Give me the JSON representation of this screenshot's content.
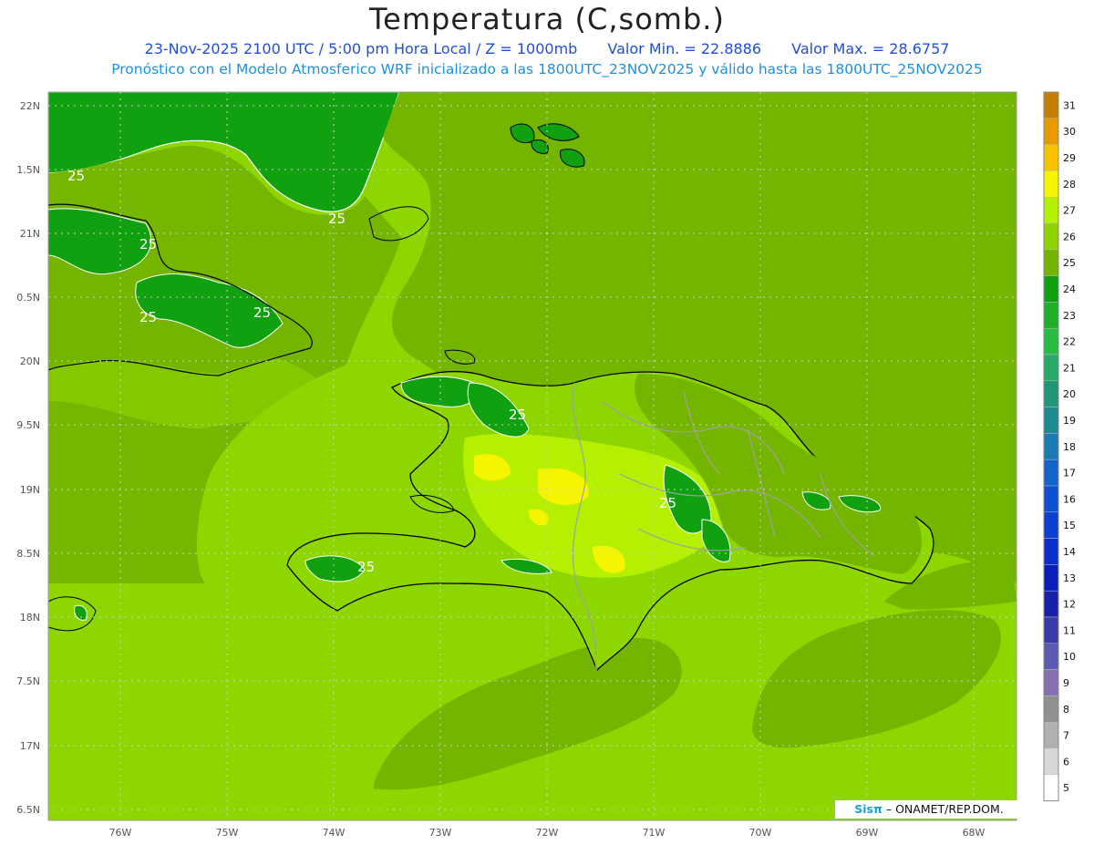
{
  "title": "Temperatura (C,somb.)",
  "subtitle": {
    "datetime": "23-Nov-2025 2100 UTC / 5:00 pm Hora Local / Z = 1000mb",
    "min": "Valor Min. = 22.8886",
    "max": "Valor Max. = 28.6757"
  },
  "model_line": "Pronóstico con el Modelo Atmosferico WRF inicializado a las 1800UTC_23NOV2025 y válido hasta las  1800UTC_25NOV2025",
  "credit": {
    "logo": "Sisπ",
    "text": "– ONAMET/REP.DOM."
  },
  "map_data": {
    "lat_labels": [
      "22N",
      "1.5N",
      "21N",
      "0.5N",
      "20N",
      "9.5N",
      "19N",
      "8.5N",
      "18N",
      "7.5N",
      "17N",
      "6.5N"
    ],
    "lon_labels": [
      "76W",
      "75W",
      "74W",
      "73W",
      "72W",
      "71W",
      "70W",
      "69W",
      "68W"
    ],
    "contour_labels": [
      "25",
      "25",
      "25",
      "25",
      "25",
      "25",
      "25",
      "25"
    ],
    "colorbar": {
      "levels": [
        "31",
        "30",
        "29",
        "28",
        "27",
        "26",
        "25",
        "24",
        "23",
        "22",
        "21",
        "20",
        "19",
        "18",
        "17",
        "16",
        "15",
        "14",
        "13",
        "12",
        "11",
        "10",
        "9",
        "8",
        "7",
        "6",
        "5"
      ],
      "colors": [
        "#c47f00",
        "#e59a00",
        "#f7c300",
        "#f5f500",
        "#b5f000",
        "#8fd400",
        "#74b500",
        "#10a010",
        "#1eb02a",
        "#28bc44",
        "#29a86a",
        "#229477",
        "#1c8a8f",
        "#1b7ab0",
        "#1463c8",
        "#0f4fd0",
        "#0d3fd0",
        "#0a2fc8",
        "#0a1fb8",
        "#1820a8",
        "#3a3aa8",
        "#5a5ab0",
        "#8670b0",
        "#909090",
        "#b0b0b0",
        "#d8d8d8",
        "#ffffff"
      ]
    },
    "colors": {
      "sea": "#8ed600",
      "land_warm": "#74b500",
      "cool": "#10a010",
      "warm": "#b5f000",
      "hot": "#f5f500",
      "coast": "#000000",
      "province_border": "#a0a0a0"
    }
  }
}
